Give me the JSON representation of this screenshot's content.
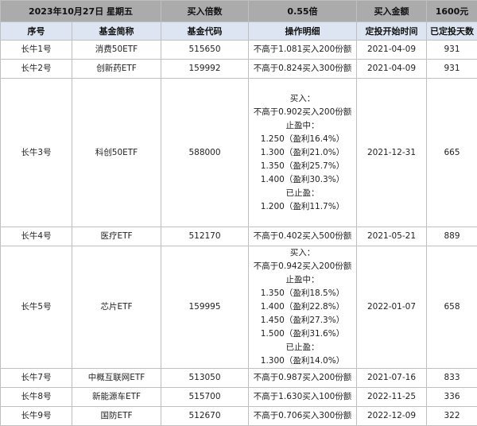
{
  "summary": {
    "date": "2023年10月27日 星期五",
    "buy_ratio_label": "买入倍数",
    "buy_ratio_value": "0.55倍",
    "buy_amount_label": "买入金额",
    "buy_amount_value": "1600元"
  },
  "headers": [
    "序号",
    "基金简称",
    "基金代码",
    "操作明细",
    "定投开始时间",
    "已定投天数"
  ],
  "rows": [
    {
      "seq": "长牛1号",
      "name": "消费50ETF",
      "code": "515650",
      "ops": [
        "不高于1.081买入200份额"
      ],
      "start": "2021-04-09",
      "days": "931"
    },
    {
      "seq": "长牛2号",
      "name": "创新药ETF",
      "code": "159992",
      "ops": [
        "不高于0.824买入300份额"
      ],
      "start": "2021-04-09",
      "days": "931"
    },
    {
      "seq": "长牛3号",
      "name": "科创50ETF",
      "code": "588000",
      "ops": [
        "买入：",
        "不高于0.902买入200份额",
        "止盈中：",
        "1.250（盈利16.4%）",
        "1.300（盈利21.0%）",
        "1.350（盈利25.7%）",
        "1.400（盈利30.3%）",
        "已止盈：",
        "1.200（盈利11.7%）"
      ],
      "start": "2021-12-31",
      "days": "665"
    },
    {
      "seq": "长牛4号",
      "name": "医疗ETF",
      "code": "512170",
      "ops": [
        "不高于0.402买入500份额"
      ],
      "start": "2021-05-21",
      "days": "889"
    },
    {
      "seq": "长牛5号",
      "name": "芯片ETF",
      "code": "159995",
      "ops": [
        "买入：",
        "不高于0.942买入200份额",
        "止盈中：",
        "1.350（盈利18.5%）",
        "1.400（盈利22.8%）",
        "1.450（盈利27.3%）",
        "1.500（盈利31.6%）",
        "已止盈：",
        "1.300（盈利14.0%）"
      ],
      "start": "2022-01-07",
      "days": "658"
    },
    {
      "seq": "长牛7号",
      "name": "中概互联网ETF",
      "code": "513050",
      "ops": [
        "不高于0.987买入200份额"
      ],
      "start": "2021-07-16",
      "days": "833"
    },
    {
      "seq": "长牛8号",
      "name": "新能源车ETF",
      "code": "515700",
      "ops": [
        "不高于1.630买入100份额"
      ],
      "start": "2022-11-25",
      "days": "336"
    },
    {
      "seq": "长牛9号",
      "name": "国防ETF",
      "code": "512670",
      "ops": [
        "不高于0.706买入300份额"
      ],
      "start": "2022-12-09",
      "days": "322"
    }
  ]
}
